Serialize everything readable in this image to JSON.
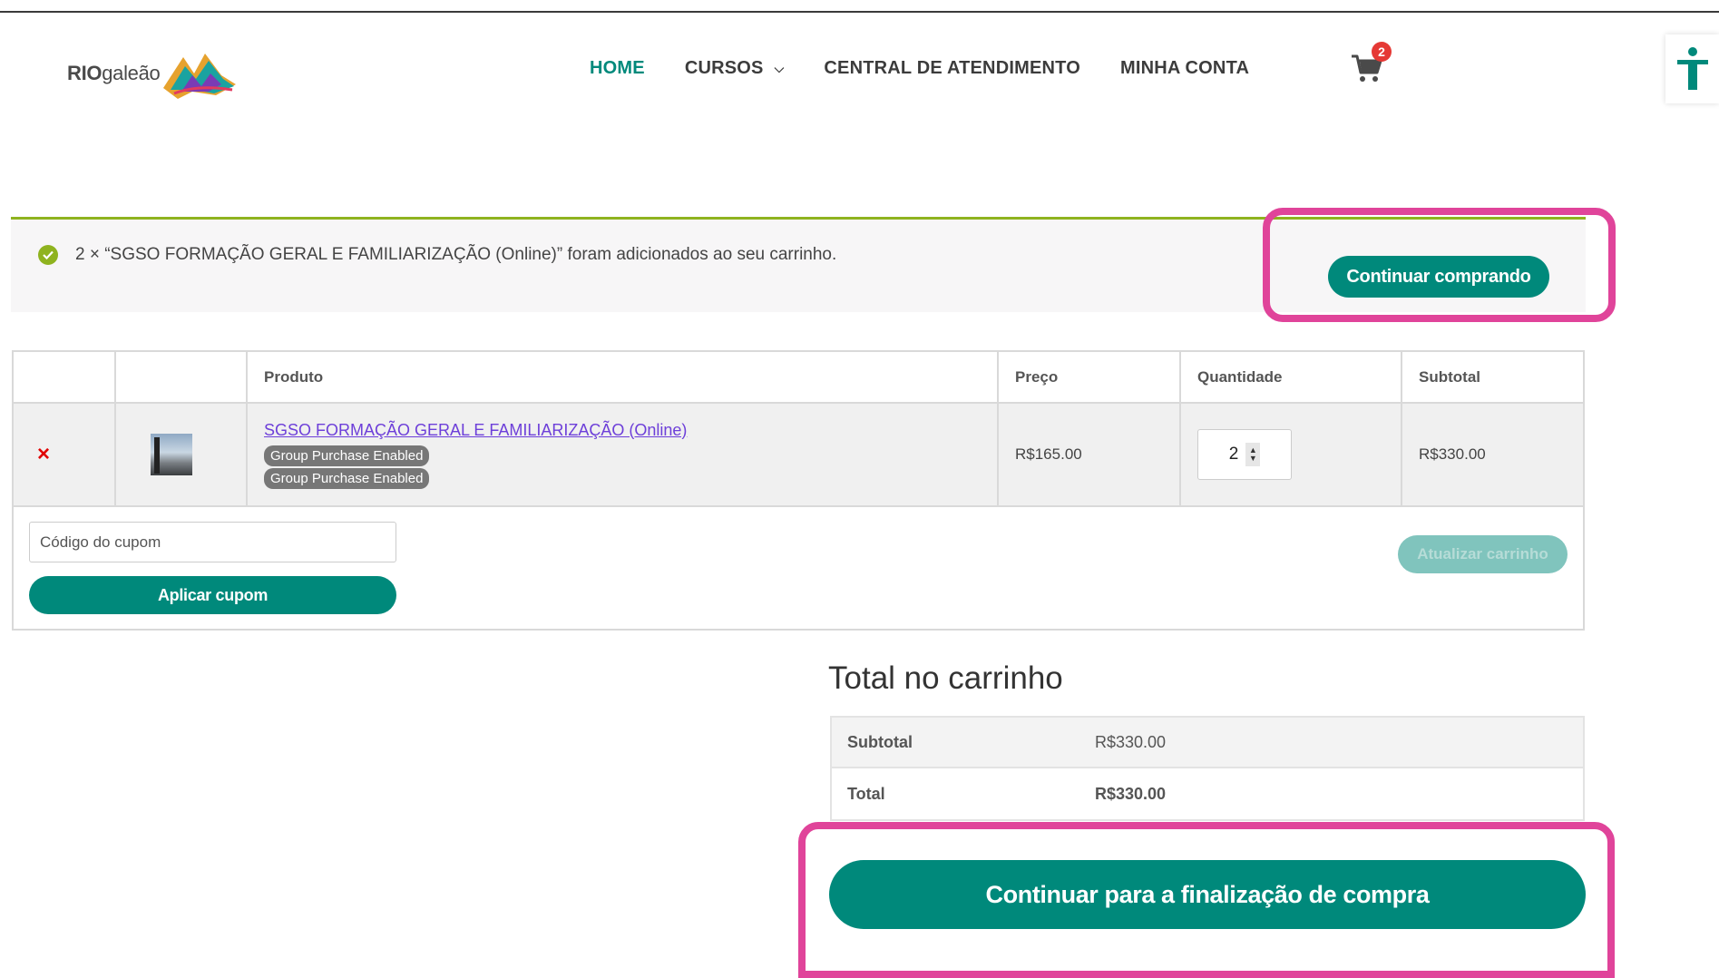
{
  "header": {
    "logo_bold": "RIO",
    "logo_rest": "galeão",
    "nav": [
      {
        "label": "HOME",
        "active": true
      },
      {
        "label": "CURSOS",
        "dropdown": true
      },
      {
        "label": "CENTRAL DE ATENDIMENTO"
      },
      {
        "label": "MINHA CONTA"
      }
    ],
    "cart_count": "2",
    "accessibility_icon": "accessibility-person-icon"
  },
  "notice": {
    "message": "2 × “SGSO FORMAÇÃO GERAL E FAMILIARIZAÇÃO (Online)” foram adicionados ao seu carrinho.",
    "continue_label": "Continuar comprando"
  },
  "cart_table": {
    "headers": [
      "",
      "",
      "Produto",
      "Preço",
      "Quantidade",
      "Subtotal"
    ],
    "items": [
      {
        "remove": "×",
        "product": "SGSO FORMAÇÃO GERAL E FAMILIARIZAÇÃO (Online)",
        "tags": [
          "Group Purchase Enabled",
          "Group Purchase Enabled"
        ],
        "price": "R$165.00",
        "quantity": "2",
        "subtotal": "R$330.00"
      }
    ],
    "coupon_placeholder": "Código do cupom",
    "apply_coupon_label": "Aplicar cupom",
    "update_cart_label": "Atualizar carrinho"
  },
  "totals": {
    "title": "Total no carrinho",
    "subtotal_label": "Subtotal",
    "subtotal_value": "R$330.00",
    "total_label": "Total",
    "total_value": "R$330.00",
    "checkout_label": "Continuar para a finalização de compra"
  },
  "colors": {
    "primary": "#00897b",
    "highlight": "#e0449a",
    "notice_border": "#8fb31f",
    "badge": "#e53935"
  }
}
